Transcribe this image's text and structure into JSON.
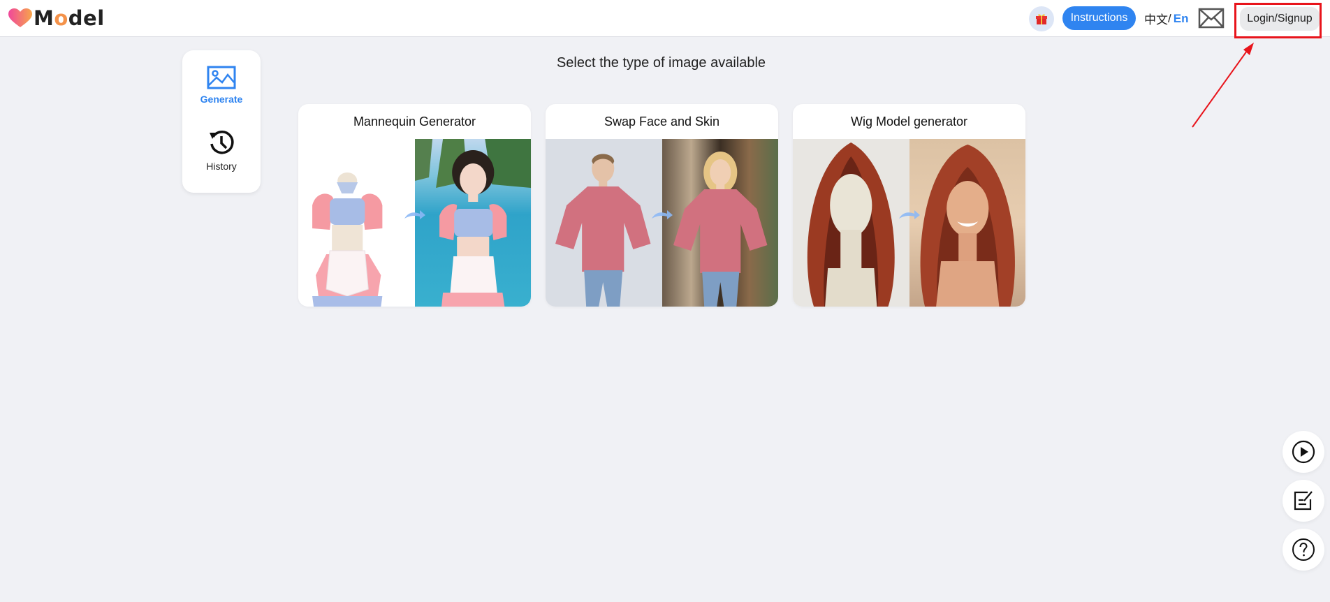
{
  "header": {
    "logo_text_prefix": "M",
    "logo_text_o": "o",
    "logo_text_suffix": "del",
    "gift_icon": "gift-icon",
    "instructions_label": "Instructions",
    "lang_zh": "中文",
    "lang_sep": "/",
    "lang_en": "En",
    "mail_icon": "mail-icon",
    "login_label": "Login/Signup"
  },
  "sidebar": {
    "items": [
      {
        "label": "Generate",
        "icon": "image-icon",
        "active": true
      },
      {
        "label": "History",
        "icon": "history-icon",
        "active": false
      }
    ]
  },
  "main": {
    "title": "Select the type of image available",
    "cards": [
      {
        "title": "Mannequin Generator",
        "before": "mannequin in maid outfit",
        "after": "model in maid outfit at beach"
      },
      {
        "title": "Swap Face and Skin",
        "before": "woman in pink t-shirt",
        "after": "blonde woman in pink t-shirt"
      },
      {
        "title": "Wig Model generator",
        "before": "red wig on mannequin head",
        "after": "smiling woman with red hair"
      }
    ]
  },
  "floating": {
    "play_icon": "play-circle-icon",
    "note_icon": "edit-note-icon",
    "help_icon": "help-circle-icon"
  },
  "colors": {
    "accent": "#2f84f0",
    "highlight": "#e8141b",
    "background": "#f0f1f5"
  }
}
